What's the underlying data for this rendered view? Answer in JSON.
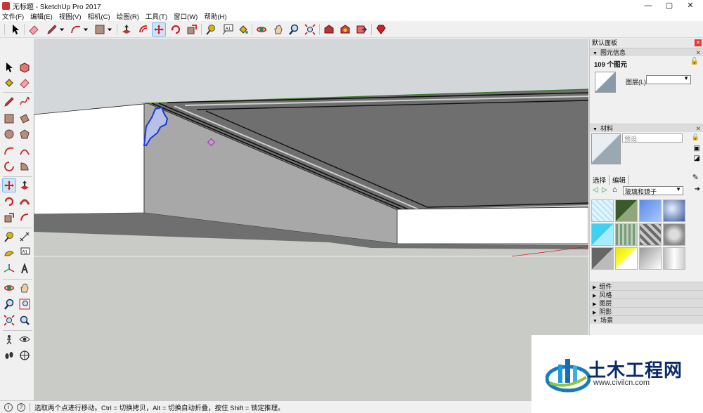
{
  "window": {
    "title": "无标题 - SketchUp Pro 2017",
    "minimize": "—",
    "maximize": "▢",
    "close": "✕"
  },
  "menu": [
    "文件(F)",
    "编辑(E)",
    "视图(V)",
    "相机(C)",
    "绘图(R)",
    "工具(T)",
    "窗口(W)",
    "帮助(H)"
  ],
  "tray": {
    "title": "默认面板",
    "entity_info": {
      "header": "图元信息",
      "count": "109 个图元",
      "layer_label": "图层(L):",
      "layer_value": ""
    },
    "materials": {
      "header": "材料",
      "name_value": "预设",
      "tab_select": "选择",
      "tab_edit": "编辑",
      "library_value": "玻璃和镜子"
    },
    "collapsed": [
      "组件",
      "风格",
      "图层",
      "阴影",
      "场景"
    ]
  },
  "status": {
    "text": "选取两个点进行移动。Ctrl = 切换拷贝，Alt = 切换自动折叠，按住 Shift = 锁定推理。",
    "icon1": "i",
    "icon2": "?"
  },
  "watermark": {
    "cn": "土木工程网",
    "url": "www.civilcn.com"
  },
  "colors": {
    "accent": "#1a7abf",
    "sky": "#d3d7d9",
    "ground": "#c9ccc6",
    "dark_face": "#6f6f6f",
    "mid_face": "#a8a8a8",
    "selection": "#1a3bd6"
  },
  "icons": {
    "toolbar": [
      "select-icon",
      "eraser-icon",
      "pencil-icon",
      "dropdown-icon",
      "arc-icon",
      "dropdown-icon",
      "rectangle-icon",
      "dropdown-icon",
      "pushpull-icon",
      "offset-icon",
      "move-icon",
      "rotate-icon",
      "scale-icon",
      "tape-icon",
      "text-icon",
      "paint-icon",
      "orbit-icon",
      "pan-icon",
      "zoom-icon",
      "zoom-extents-icon",
      "warehouse-icon",
      "extension-icon",
      "share-icon",
      "ruby-icon"
    ]
  }
}
